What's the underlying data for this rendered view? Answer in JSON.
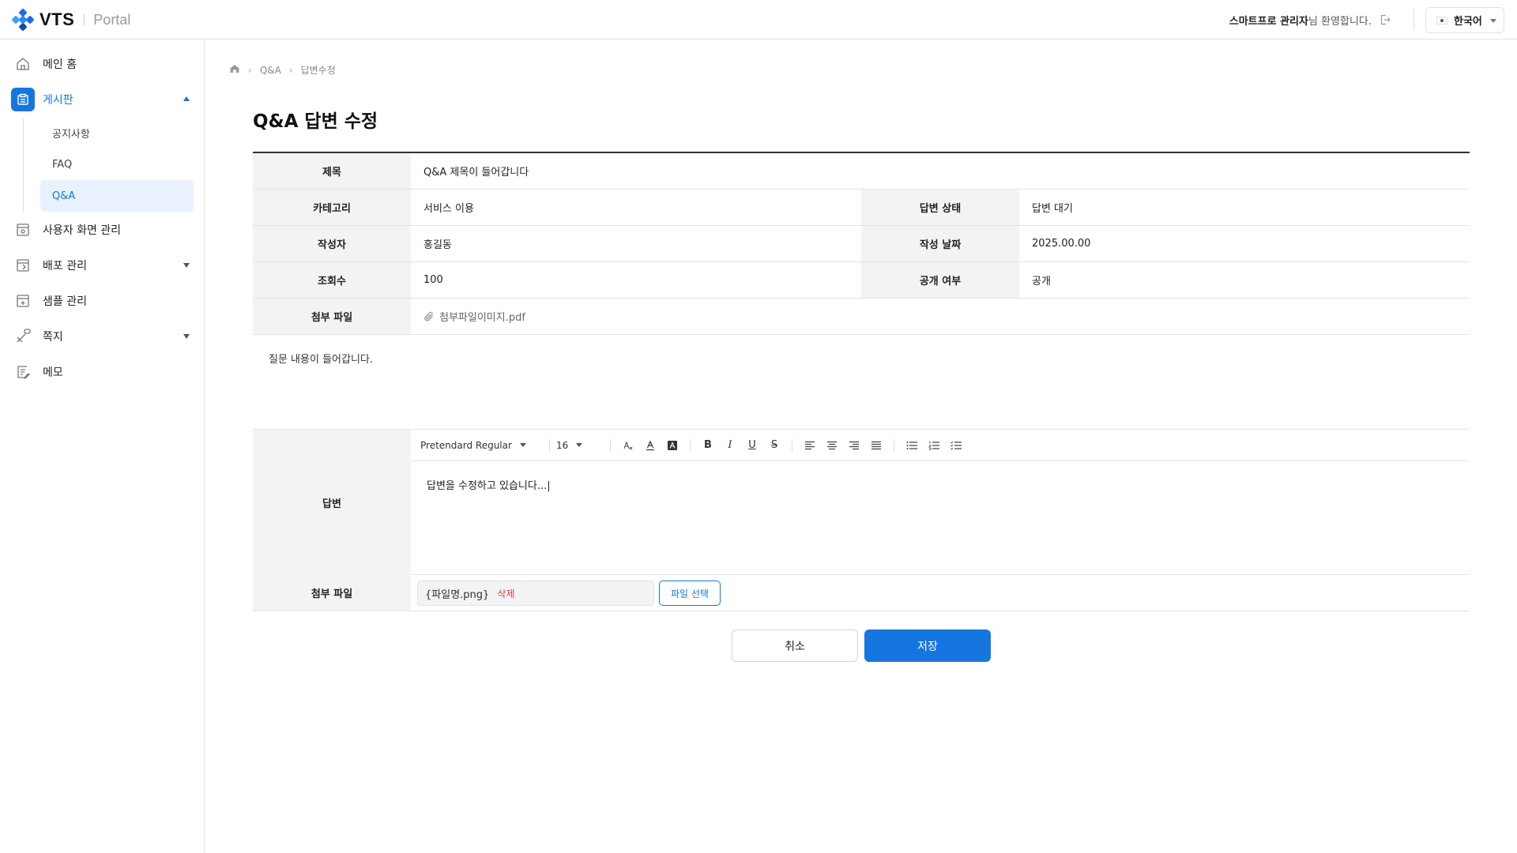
{
  "header": {
    "logo_text": "VTS",
    "logo_sub": "Portal",
    "welcome_name": "스마트프로 관리자",
    "welcome_suffix": "님 환영합니다.",
    "language": "한국어"
  },
  "sidebar": {
    "items": [
      {
        "label": "메인 홈",
        "icon": "home-icon"
      },
      {
        "label": "게시판",
        "icon": "board-icon"
      },
      {
        "label": "사용자 화면 관리",
        "icon": "screen-settings-icon"
      },
      {
        "label": "배포 관리",
        "icon": "deploy-icon"
      },
      {
        "label": "샘플 관리",
        "icon": "sample-icon"
      },
      {
        "label": "쪽지",
        "icon": "message-icon"
      },
      {
        "label": "메모",
        "icon": "memo-icon"
      }
    ],
    "subitems": [
      "공지사항",
      "FAQ",
      "Q&A"
    ]
  },
  "breadcrumb": {
    "level1": "Q&A",
    "level2": "답변수정"
  },
  "page_title": "Q&A 답변 수정",
  "form": {
    "title_label": "제목",
    "title_value": "Q&A 제목이 들어갑니다",
    "category_label": "카테고리",
    "category_value": "서비스 이용",
    "status_label": "답변 상태",
    "status_value": "답변 대기",
    "author_label": "작성자",
    "author_value": "홍길동",
    "date_label": "작성 날짜",
    "date_value": "2025.00.00",
    "views_label": "조회수",
    "views_value": "100",
    "public_label": "공개 여부",
    "public_value": "공개",
    "attach_label": "첨부 파일",
    "attach_value": "첨부파일이미지.pdf",
    "question": "질문 내용이 들어갑니다.",
    "answer_label": "답변",
    "toolbar_font": "Pretendard Regular",
    "toolbar_size": "16",
    "answer_text": "답변을 수정하고 있습니다...|",
    "answer_attach_label": "첨부 파일",
    "file_name": "{파일명.png}",
    "file_delete": "삭제",
    "file_select": "파일 선택"
  },
  "actions": {
    "cancel": "취소",
    "save": "저장"
  },
  "colors": {
    "primary": "#1676e0",
    "danger": "#e04040"
  }
}
